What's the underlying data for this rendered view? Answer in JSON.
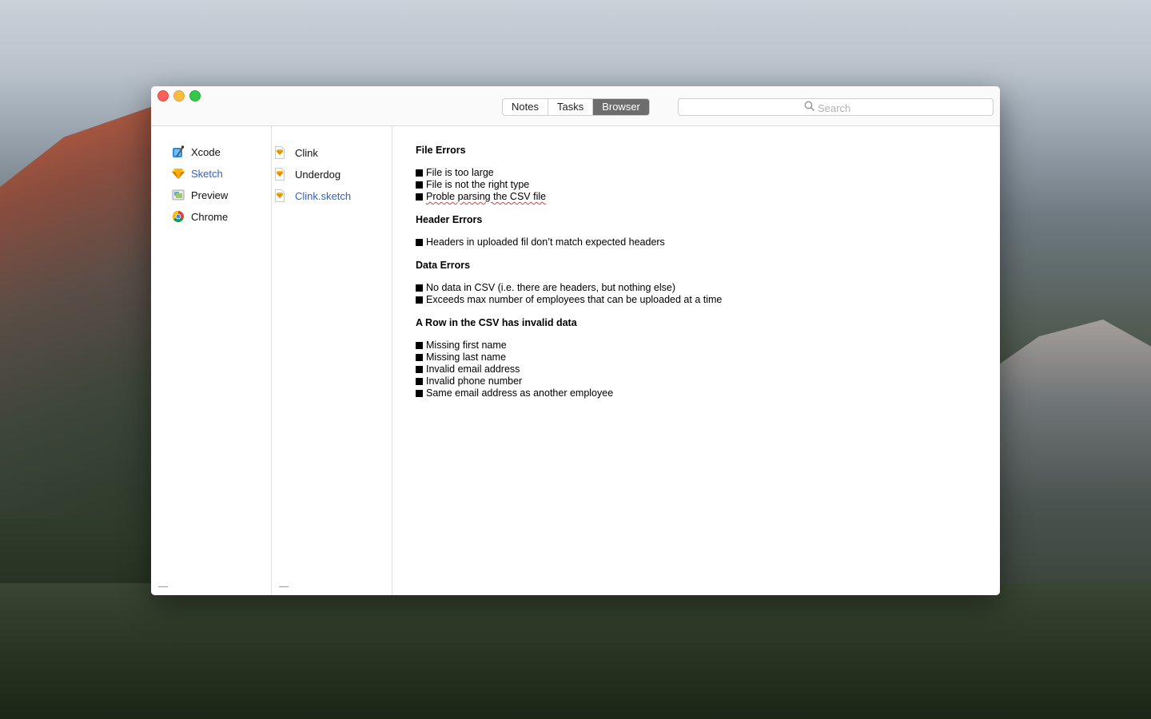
{
  "window": {
    "tabs": [
      {
        "label": "Notes",
        "active": false
      },
      {
        "label": "Tasks",
        "active": false
      },
      {
        "label": "Browser",
        "active": true
      }
    ],
    "search": {
      "placeholder": "Search",
      "icon": "search-icon"
    }
  },
  "sidebar": {
    "apps": [
      {
        "label": "Xcode",
        "icon": "xcode-icon",
        "selected": false
      },
      {
        "label": "Sketch",
        "icon": "sketch-icon",
        "selected": true
      },
      {
        "label": "Preview",
        "icon": "preview-icon",
        "selected": false
      },
      {
        "label": "Chrome",
        "icon": "chrome-icon",
        "selected": false
      }
    ]
  },
  "files": {
    "items": [
      {
        "label": "Clink",
        "icon": "sketch-file-icon",
        "selected": false
      },
      {
        "label": "Underdog",
        "icon": "sketch-file-icon",
        "selected": false
      },
      {
        "label": "Clink.sketch",
        "icon": "sketch-file-icon",
        "selected": true
      }
    ]
  },
  "document": {
    "sections": [
      {
        "heading": "File Errors",
        "items": [
          "File is too large",
          "File is not the right type",
          "Proble parsing the CSV file"
        ]
      },
      {
        "heading": "Header Errors",
        "items": [
          "Headers in uploaded fil don’t match expected headers"
        ]
      },
      {
        "heading": "Data Errors",
        "items": [
          "No data in CSV (i.e. there are headers, but nothing else)",
          "Exceeds max number of employees that can be uploaded at a time"
        ]
      },
      {
        "heading": "A Row in the CSV has invalid data",
        "items": [
          "Missing first name",
          "Missing last name",
          "Invalid email address",
          "Invalid phone number",
          "Same email address as another employee"
        ]
      }
    ]
  },
  "colors": {
    "selection_text": "#2f63c6",
    "active_segment": "#6d6d6d"
  }
}
